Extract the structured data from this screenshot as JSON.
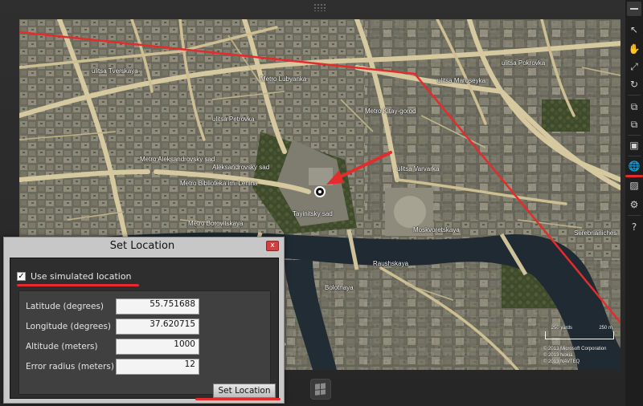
{
  "map": {
    "labels": [
      "ulitsa Pokrovka",
      "ulitsa Maroseyka",
      "ulitsa Varvarka",
      "Moskvoretskaya",
      "Metro Lubyanka",
      "Metro Kitay-gorod",
      "Metro Biblioteka im. Lenina",
      "Aleksandrovsky sad",
      "Metro Aleksandrovsky sad",
      "Tayinitsky sad",
      "Serebrianiches",
      "Metro Borovitskaya",
      "Raushskaya",
      "ulitsa Petrovka",
      "ulitsa Tverskaya",
      "Bolotnaya"
    ],
    "scale": {
      "left": "250 yards",
      "right": "250 m"
    },
    "attribution": [
      "© 2013 Microsoft Corporation",
      "© 2013 Nokia",
      "© 2013 NAVTEQ"
    ],
    "annotation_color": "#e32c2c"
  },
  "toolbar": {
    "icons": [
      "minimize-icon",
      "pointer-icon",
      "hand-icon",
      "pinch-zoom-icon",
      "rotate-icon",
      "rotate-clockwise-icon",
      "rotate-counterclockwise-icon",
      "change-resolution-icon",
      "location-icon",
      "screenshot-icon",
      "settings-icon",
      "help-icon"
    ],
    "help_label": "?"
  },
  "dialog": {
    "title": "Set Location",
    "close_label": "x",
    "use_simulated_label": "Use simulated location",
    "use_simulated_checked": true,
    "fields": [
      {
        "label": "Latitude (degrees)",
        "value": "55.751688"
      },
      {
        "label": "Longitude (degrees)",
        "value": "37.620715"
      },
      {
        "label": "Altitude (meters)",
        "value": "1000"
      },
      {
        "label": "Error radius (meters)",
        "value": "12"
      }
    ],
    "set_button_label": "Set Location"
  }
}
